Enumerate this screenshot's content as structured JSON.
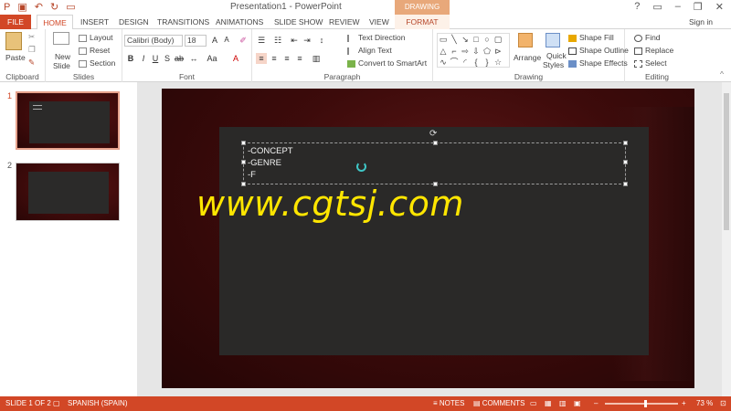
{
  "title_bar": {
    "document_title": "Presentation1 - PowerPoint",
    "context_tools": "DRAWING TOOLS",
    "window_controls": [
      "?",
      "▭",
      "–",
      "❐",
      "✕"
    ]
  },
  "tabs": [
    {
      "label": "FILE"
    },
    {
      "label": "HOME"
    },
    {
      "label": "INSERT"
    },
    {
      "label": "DESIGN"
    },
    {
      "label": "TRANSITIONS"
    },
    {
      "label": "ANIMATIONS"
    },
    {
      "label": "SLIDE SHOW"
    },
    {
      "label": "REVIEW"
    },
    {
      "label": "VIEW"
    },
    {
      "label": "FORMAT"
    }
  ],
  "sign_in": "Sign in",
  "ribbon": {
    "clipboard": {
      "paste": "Paste",
      "label": "Clipboard"
    },
    "slides": {
      "new_slide_1": "New",
      "new_slide_2": "Slide",
      "layout": "Layout",
      "reset": "Reset",
      "section": "Section",
      "label": "Slides"
    },
    "font": {
      "font_name": "Calibri (Body)",
      "font_size": "18",
      "label": "Font"
    },
    "paragraph": {
      "text_direction": "Text Direction",
      "align_text": "Align Text",
      "convert_smartart": "Convert to SmartArt",
      "label": "Paragraph"
    },
    "drawing": {
      "arrange": "Arrange",
      "quick_styles_1": "Quick",
      "quick_styles_2": "Styles",
      "shape_fill": "Shape Fill",
      "shape_outline": "Shape Outline",
      "shape_effects": "Shape Effects",
      "label": "Drawing"
    },
    "editing": {
      "find": "Find",
      "replace": "Replace",
      "select": "Select",
      "label": "Editing"
    }
  },
  "slides": [
    {
      "number": "1"
    },
    {
      "number": "2"
    }
  ],
  "slide_text": {
    "line1": "-CONCEPT",
    "line2": "-GENRE",
    "line3": "-F"
  },
  "watermark": "www.cgtsj.com",
  "status_bar": {
    "slide_info": "SLIDE 1 OF 2",
    "language": "SPANISH (SPAIN)",
    "notes": "NOTES",
    "comments": "COMMENTS",
    "zoom": "73 %"
  },
  "colors": {
    "accent": "#d24726",
    "slide_bg": "#3d0b0b",
    "content_box": "#2a2928",
    "watermark": "#ffe600"
  }
}
